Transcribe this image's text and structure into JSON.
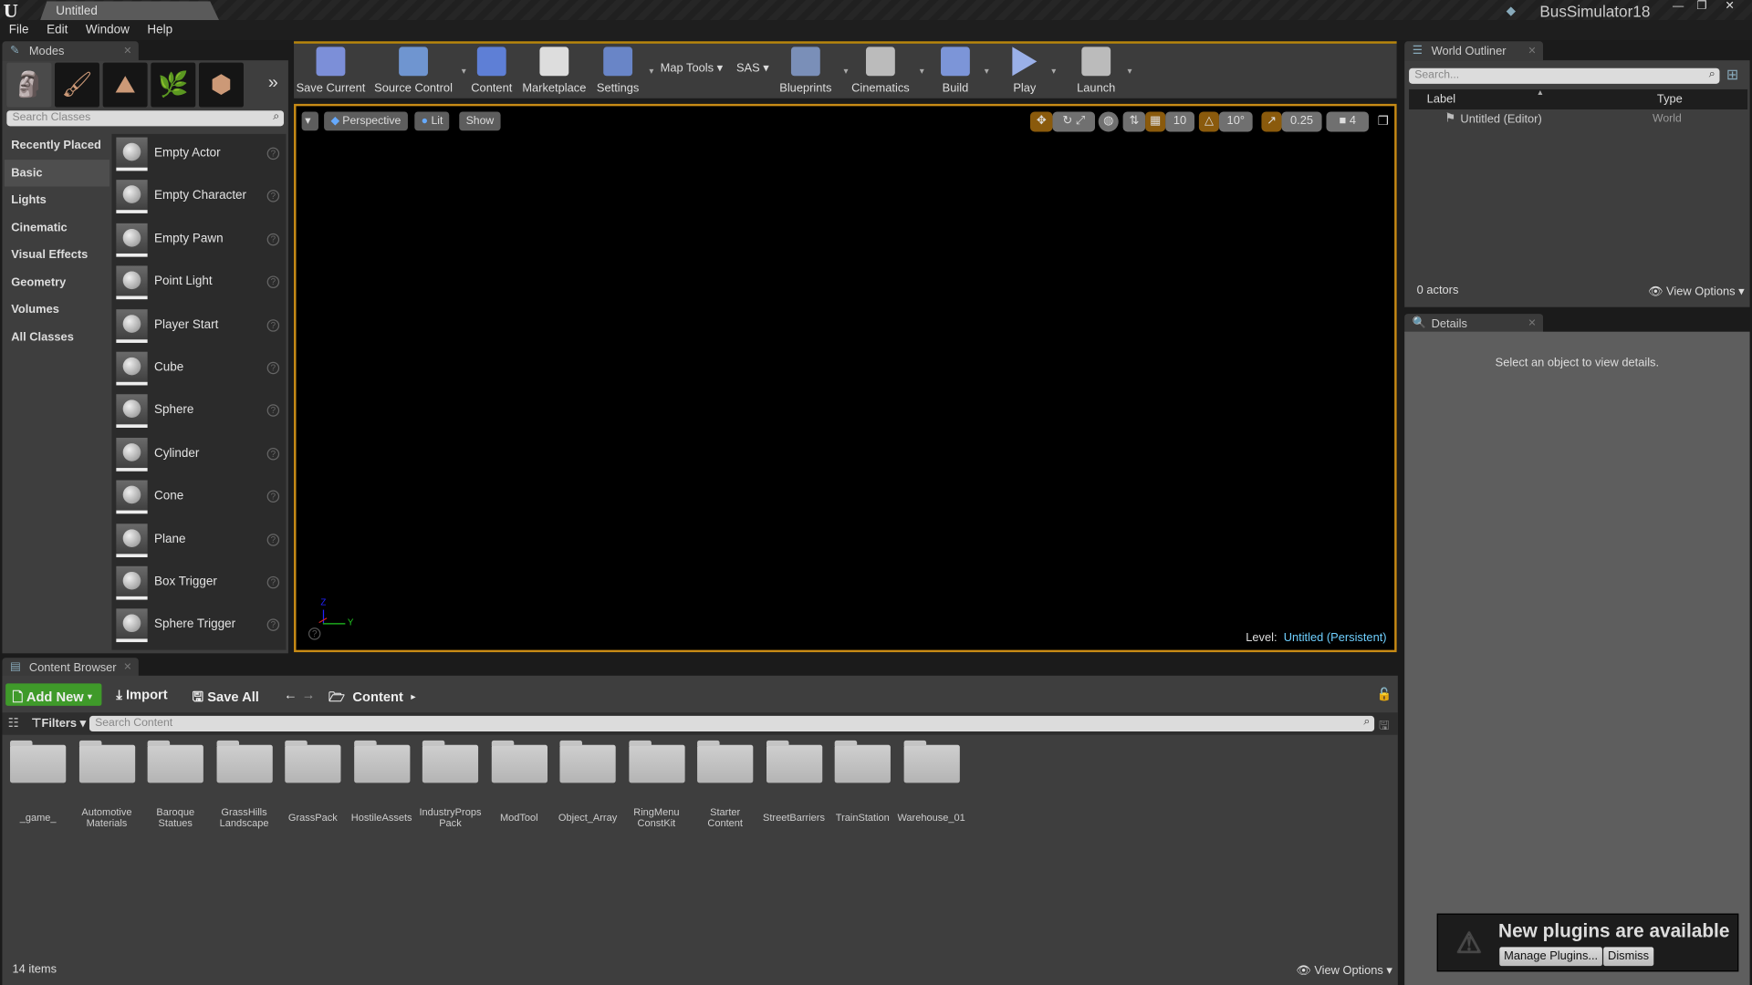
{
  "window": {
    "doc_tab": "Untitled",
    "app_name": "BusSimulator18"
  },
  "menu": [
    "File",
    "Edit",
    "Window",
    "Help"
  ],
  "modes": {
    "tab": "Modes",
    "search_placeholder": "Search Classes",
    "mode_icons": [
      "place-mode-icon",
      "paint-mode-icon",
      "landscape-mode-icon",
      "foliage-mode-icon",
      "geometry-mode-icon"
    ],
    "categories": [
      "Recently Placed",
      "Basic",
      "Lights",
      "Cinematic",
      "Visual Effects",
      "Geometry",
      "Volumes",
      "All Classes"
    ],
    "selected_category": "Basic",
    "items": [
      "Empty Actor",
      "Empty Character",
      "Empty Pawn",
      "Point Light",
      "Player Start",
      "Cube",
      "Sphere",
      "Cylinder",
      "Cone",
      "Plane",
      "Box Trigger",
      "Sphere Trigger"
    ]
  },
  "toolbar": {
    "buttons": [
      {
        "label": "Save Current",
        "icon": "save-icon",
        "dropdown": false
      },
      {
        "label": "Source Control",
        "icon": "source-control-icon",
        "dropdown": true
      },
      {
        "label": "Content",
        "icon": "content-icon",
        "dropdown": false
      },
      {
        "label": "Marketplace",
        "icon": "marketplace-icon",
        "dropdown": false
      },
      {
        "label": "Settings",
        "icon": "settings-icon",
        "dropdown": true
      },
      {
        "label": "Blueprints",
        "icon": "blueprints-icon",
        "dropdown": true
      },
      {
        "label": "Cinematics",
        "icon": "cinematics-icon",
        "dropdown": true
      },
      {
        "label": "Build",
        "icon": "build-icon",
        "dropdown": true
      },
      {
        "label": "Play",
        "icon": "play-icon",
        "dropdown": true
      },
      {
        "label": "Launch",
        "icon": "launch-icon",
        "dropdown": true
      }
    ],
    "map_tools": "Map Tools",
    "sas": "SAS"
  },
  "viewport": {
    "perspective": "Perspective",
    "lit": "Lit",
    "show": "Show",
    "grid_snap": "10",
    "rotation_snap": "10°",
    "scale_snap": "0.25",
    "camera_speed": "4",
    "level_label": "Level:",
    "level_name": "Untitled (Persistent)",
    "axis_z": "Z",
    "axis_y": "Y"
  },
  "outliner": {
    "tab": "World Outliner",
    "search_placeholder": "Search...",
    "col_label": "Label",
    "col_type": "Type",
    "rows": [
      {
        "label": "Untitled (Editor)",
        "type": "World"
      }
    ],
    "count": "0 actors",
    "view_options": "View Options"
  },
  "details": {
    "tab": "Details",
    "empty": "Select an object to view details."
  },
  "content_browser": {
    "tab": "Content Browser",
    "add_new": "Add New",
    "import": "Import",
    "save_all": "Save All",
    "path": "Content",
    "filters": "Filters",
    "search_placeholder": "Search Content",
    "folders": [
      "_game_",
      "Automotive Materials",
      "Baroque Statues",
      "GrassHills Landscape",
      "GrassPack",
      "HostileAssets",
      "IndustryProps Pack",
      "ModTool",
      "Object_Array",
      "RingMenu ConstKit",
      "Starter Content",
      "StreetBarriers",
      "TrainStation",
      "Warehouse_01"
    ],
    "item_count": "14 items",
    "view_options": "View Options"
  },
  "notification": {
    "title": "New plugins are available",
    "manage": "Manage Plugins...",
    "dismiss": "Dismiss"
  },
  "colors": {
    "accent": "#c88b16",
    "level_link": "#6fd0ff",
    "add_new": "#3f9a2a"
  }
}
